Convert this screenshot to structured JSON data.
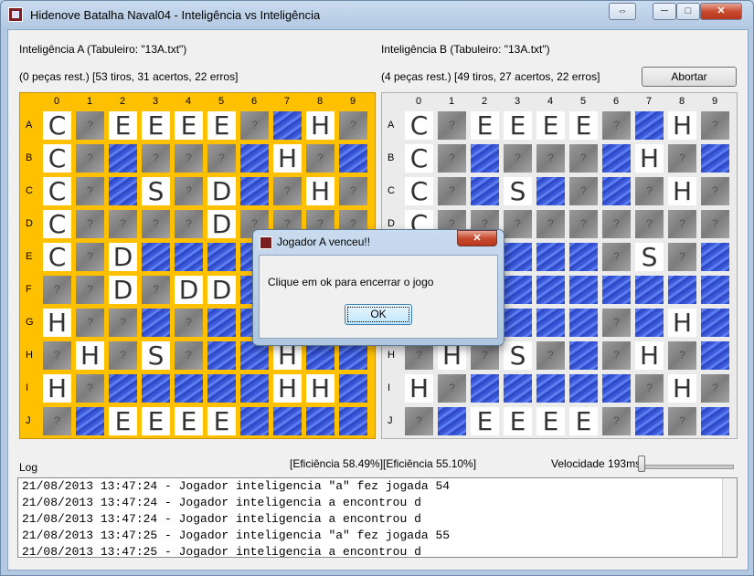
{
  "window": {
    "title": "Hidenove Batalha Naval04 - Inteligência vs Inteligência",
    "buttons": {
      "extra": "⇔",
      "minimize": "─",
      "maximize": "□",
      "close": "✕"
    }
  },
  "player_a": {
    "title": "Inteligência A (Tabuleiro: \"13A.txt\")",
    "stats": "(0 peças rest.)  [53 tiros, 31 acertos, 22 erros]",
    "efficiency": "[Eficiência 58.49%]"
  },
  "player_b": {
    "title": "Inteligência B (Tabuleiro: \"13A.txt\")",
    "stats": "(4 peças rest.)  [49 tiros, 27 acertos, 22 erros]",
    "efficiency": "[Eficiência 55.10%]"
  },
  "abort_label": "Abortar",
  "columns": [
    "0",
    "1",
    "2",
    "3",
    "4",
    "5",
    "6",
    "7",
    "8",
    "9"
  ],
  "rows": [
    "A",
    "B",
    "C",
    "D",
    "E",
    "F",
    "G",
    "H",
    "I",
    "J"
  ],
  "legend": {
    "unknown": "?",
    "water": "~"
  },
  "board_a": [
    [
      "C",
      "?",
      "E",
      "E",
      "E",
      "E",
      "?",
      "~",
      "H",
      "?"
    ],
    [
      "C",
      "?",
      "~",
      "?",
      "?",
      "?",
      "~",
      "H",
      "?",
      "~"
    ],
    [
      "C",
      "?",
      "~",
      "S",
      "?",
      "D",
      "~",
      "?",
      "H",
      "?"
    ],
    [
      "C",
      "?",
      "?",
      "?",
      "?",
      "D",
      "?",
      "?",
      "?",
      "?"
    ],
    [
      "C",
      "?",
      "D",
      "~",
      "~",
      "~",
      "~",
      "~",
      "~",
      "~"
    ],
    [
      "?",
      "?",
      "D",
      "?",
      "D",
      "D",
      "~",
      "~",
      "~",
      "~"
    ],
    [
      "H",
      "?",
      "?",
      "~",
      "?",
      "~",
      "~",
      "~",
      "~",
      "~"
    ],
    [
      "?",
      "H",
      "?",
      "S",
      "?",
      "~",
      "~",
      "H",
      "~",
      "~"
    ],
    [
      "H",
      "?",
      "~",
      "~",
      "~",
      "~",
      "~",
      "H",
      "H",
      "~"
    ],
    [
      "?",
      "~",
      "E",
      "E",
      "E",
      "E",
      "~",
      "~",
      "~",
      "~"
    ]
  ],
  "board_b": [
    [
      "C",
      "?",
      "E",
      "E",
      "E",
      "E",
      "?",
      "~",
      "H",
      "?"
    ],
    [
      "C",
      "?",
      "~",
      "?",
      "?",
      "?",
      "~",
      "H",
      "?",
      "~"
    ],
    [
      "C",
      "?",
      "~",
      "S",
      "~",
      "?",
      "~",
      "?",
      "H",
      "?"
    ],
    [
      "C",
      "?",
      "?",
      "?",
      "?",
      "?",
      "?",
      "?",
      "?",
      "?"
    ],
    [
      "?",
      "?",
      "~",
      "~",
      "~",
      "~",
      "?",
      "S",
      "?",
      "~"
    ],
    [
      "?",
      "?",
      "~",
      "~",
      "~",
      "~",
      "~",
      "~",
      "~",
      "~"
    ],
    [
      "?",
      "?",
      "~",
      "~",
      "~",
      "~",
      "?",
      "~",
      "H",
      "~"
    ],
    [
      "?",
      "H",
      "?",
      "S",
      "?",
      "~",
      "?",
      "H",
      "?",
      "~"
    ],
    [
      "H",
      "?",
      "~",
      "~",
      "~",
      "~",
      "~",
      "?",
      "H",
      "?"
    ],
    [
      "?",
      "~",
      "E",
      "E",
      "E",
      "E",
      "?",
      "~",
      "?",
      "~"
    ]
  ],
  "log": {
    "label": "Log",
    "lines": [
      "21/08/2013 13:47:24 - Jogador inteligencia \"a\" fez jogada 54",
      "21/08/2013 13:47:24 - Jogador inteligencia a encontrou d",
      "21/08/2013 13:47:24 - Jogador inteligencia a encontrou d",
      "21/08/2013 13:47:25 - Jogador inteligencia \"a\" fez jogada 55",
      "21/08/2013 13:47:25 - Jogador inteligencia a encontrou d"
    ]
  },
  "speed": {
    "label": "Velocidade 193ms",
    "level": 0.0
  },
  "dialog": {
    "title": "Jogador A venceu!!",
    "message": "Clique em ok para encerrar o jogo",
    "ok_label": "OK",
    "close": "✕"
  }
}
